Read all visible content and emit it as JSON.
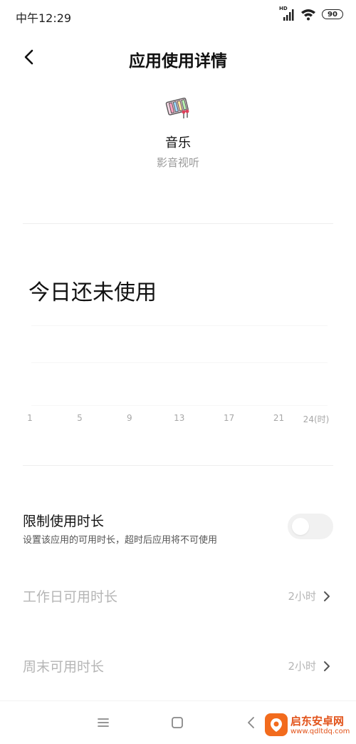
{
  "status_bar": {
    "time": "中午12:29",
    "network_label": "HD",
    "battery": "90",
    "icons": [
      "hd-signal-icon",
      "wifi-icon",
      "battery-icon"
    ]
  },
  "header": {
    "title": "应用使用详情",
    "back_icon": "back-arrow-icon"
  },
  "app": {
    "name": "音乐",
    "category": "影音视听",
    "icon": "music-app-icon"
  },
  "usage": {
    "headline": "今日还未使用"
  },
  "chart_data": {
    "type": "bar",
    "x_ticks": [
      "1",
      "5",
      "9",
      "13",
      "17",
      "21",
      "24(时)"
    ],
    "values": [],
    "grid": true
  },
  "limit": {
    "title": "限制使用时长",
    "description": "设置该应用的可用时长，超时后应用将不可使用",
    "enabled": false
  },
  "settings": [
    {
      "label": "工作日可用时长",
      "value": "2小时"
    },
    {
      "label": "周末可用时长",
      "value": "2小时"
    }
  ],
  "system_nav": {
    "icons": [
      "menu-icon",
      "home-icon",
      "back-icon"
    ]
  },
  "watermark": {
    "name": "启东安卓网",
    "url": "www.qdltdq.com"
  },
  "colors": {
    "text_primary": "#111111",
    "text_secondary": "#9a9a9a",
    "text_disabled": "#b5b5b5",
    "toggle_off": "#f1f1f1",
    "watermark": "#f26b1d"
  }
}
